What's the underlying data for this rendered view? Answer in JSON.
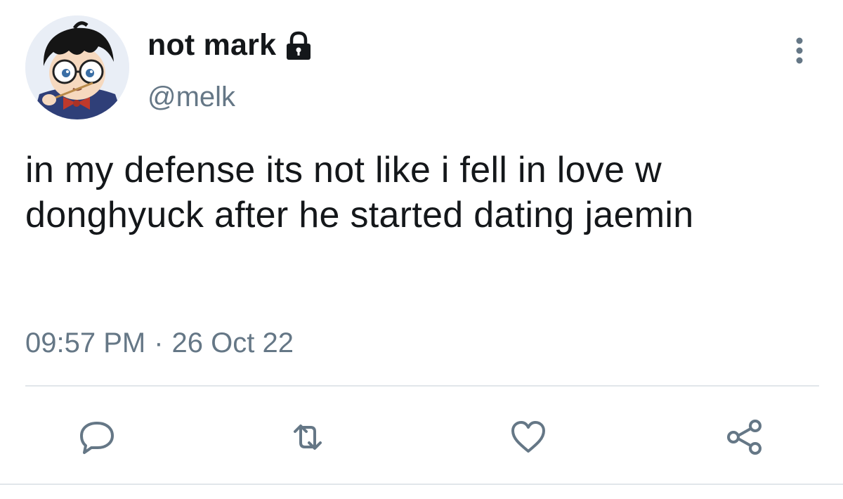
{
  "tweet": {
    "display_name": "not mark",
    "handle": "@melk",
    "text": "in my defense its not like i fell in love w donghyuck after he started dating jaemin",
    "time": "09:57 PM",
    "separator": "·",
    "date": "26 Oct 22",
    "protected_icon": "lock-icon",
    "more_icon": "more-vertical-icon"
  },
  "actions": [
    {
      "name": "reply",
      "icon": "reply-icon"
    },
    {
      "name": "retweet",
      "icon": "retweet-icon"
    },
    {
      "name": "like",
      "icon": "heart-icon"
    },
    {
      "name": "share",
      "icon": "share-icon"
    }
  ],
  "colors": {
    "text": "#14171a",
    "secondary": "#657786",
    "divider": "#e1e6ea",
    "icon": "#657786"
  }
}
